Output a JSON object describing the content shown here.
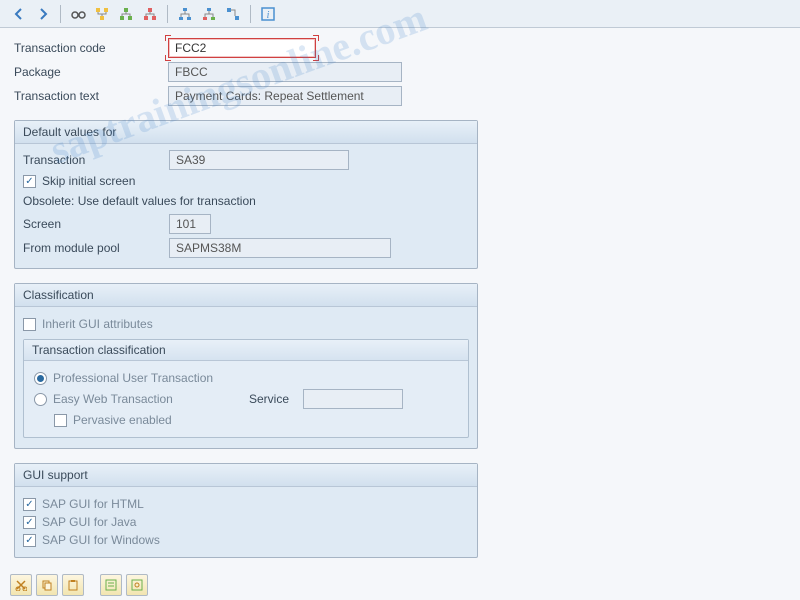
{
  "toolbar": {
    "icons": [
      "back",
      "forward",
      "glasses",
      "tree1",
      "tree2",
      "tree3",
      "hier1",
      "hier2",
      "hier3",
      "info"
    ]
  },
  "header": {
    "tcode_label": "Transaction code",
    "tcode_value": "FCC2",
    "package_label": "Package",
    "package_value": "FBCC",
    "ttext_label": "Transaction text",
    "ttext_value": "Payment Cards: Repeat Settlement"
  },
  "defaults": {
    "title": "Default values for",
    "transaction_label": "Transaction",
    "transaction_value": "SA39",
    "skip_label": "Skip initial screen",
    "skip_checked": true,
    "obsolete_text": "Obsolete: Use default values for transaction",
    "screen_label": "Screen",
    "screen_value": "101",
    "pool_label": "From module pool",
    "pool_value": "SAPMS38M"
  },
  "classification": {
    "title": "Classification",
    "inherit_label": "Inherit GUI attributes",
    "inherit_checked": false,
    "sub_title": "Transaction classification",
    "pro_label": "Professional User Transaction",
    "easy_label": "Easy Web Transaction",
    "service_label": "Service",
    "pervasive_label": "Pervasive enabled",
    "selected_radio": "pro"
  },
  "gui": {
    "title": "GUI support",
    "html_label": "SAP GUI for HTML",
    "java_label": "SAP GUI for Java",
    "win_label": "SAP GUI for Windows"
  },
  "watermark": "saptrainingsonline.com"
}
